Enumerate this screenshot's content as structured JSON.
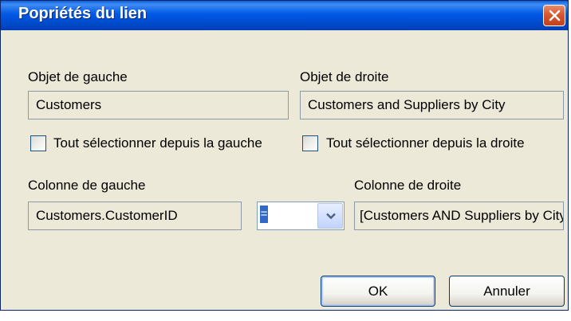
{
  "window": {
    "title": "Popriétés du lien"
  },
  "left_object": {
    "label": "Objet de gauche",
    "value": "Customers",
    "select_all_label": "Tout sélectionner depuis la gauche"
  },
  "right_object": {
    "label": "Objet de droite",
    "value": "Customers and Suppliers by City",
    "select_all_label": "Tout sélectionner depuis la droite"
  },
  "left_column": {
    "label": "Colonne de gauche",
    "value": "Customers.CustomerID"
  },
  "operator": {
    "value": "="
  },
  "right_column": {
    "label": "Colonne de droite",
    "value": "[Customers AND Suppliers by City].CustomerID"
  },
  "buttons": {
    "ok": "OK",
    "cancel": "Annuler"
  },
  "icons": {
    "close": "close-icon",
    "dropdown": "chevron-down-icon"
  },
  "colors": {
    "titlebar": "#0058e6",
    "close_button": "#d5542d",
    "dialog_background": "#ece9d8",
    "selection": "#316ac5"
  }
}
